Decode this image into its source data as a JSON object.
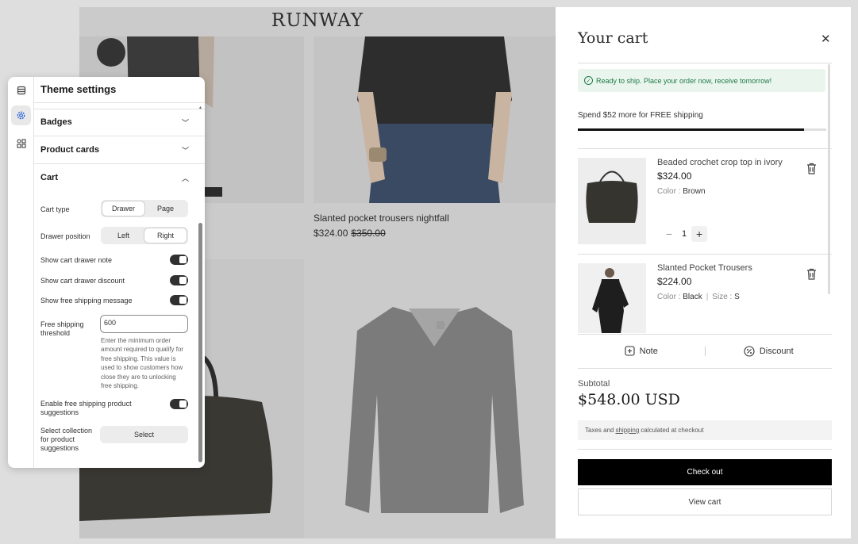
{
  "store": {
    "logo": "RUNWAY",
    "product_name": "Slanted pocket trousers nightfall",
    "product_price": "$324.00",
    "product_old_price": "$350.00"
  },
  "settings": {
    "title": "Theme settings",
    "sections": [
      {
        "label": "Badges",
        "expanded": false
      },
      {
        "label": "Product cards",
        "expanded": false
      },
      {
        "label": "Cart",
        "expanded": true
      }
    ],
    "cart_type": {
      "label": "Cart type",
      "options": [
        "Drawer",
        "Page"
      ],
      "selected": "Drawer"
    },
    "drawer_position": {
      "label": "Drawer position",
      "options": [
        "Left",
        "Right"
      ],
      "selected": "Right"
    },
    "toggles": [
      {
        "label": "Show cart drawer note",
        "on": true
      },
      {
        "label": "Show cart drawer discount",
        "on": true
      },
      {
        "label": "Show free shipping message",
        "on": true
      }
    ],
    "threshold": {
      "label_line1": "Free shipping",
      "label_line2": "threshold",
      "value": "600",
      "help": "Enter the minimum order amount required to qualify for free shipping. This value is used to show customers how close they are to unlocking free shipping."
    },
    "suggestions_toggle": {
      "label_line1": "Enable free shipping product",
      "label_line2": "suggestions",
      "on": true
    },
    "select_collection": {
      "label_line1": "Select collection",
      "label_line2": "for product",
      "label_line3": "suggestions",
      "button": "Select"
    }
  },
  "cart": {
    "title": "Your cart",
    "ready_message": "Ready to ship. Place your order now, receive tomorrow!",
    "shipping_message": "Spend $52 more for FREE shipping",
    "shipping_progress": 0.91,
    "items": [
      {
        "name": "Beaded crochet crop top in ivory",
        "price": "$324.00",
        "color_label": "Color :",
        "color": "Brown",
        "quantity": "1"
      },
      {
        "name": "Slanted Pocket Trousers",
        "price": "$224.00",
        "color_label": "Color :",
        "color": "Black",
        "size_label": "Size :",
        "size": "S"
      }
    ],
    "note_label": "Note",
    "discount_label": "Discount",
    "subtotal_label": "Subtotal",
    "subtotal": "$548.00 USD",
    "tax_prefix": "Taxes and",
    "tax_link": "shipping",
    "tax_suffix": "calculated at checkout",
    "checkout_label": "Check out",
    "view_cart_label": "View cart"
  },
  "colors": {
    "accent": "#000000",
    "success": "#1f7a45",
    "success_bg": "#eaf5ee"
  }
}
